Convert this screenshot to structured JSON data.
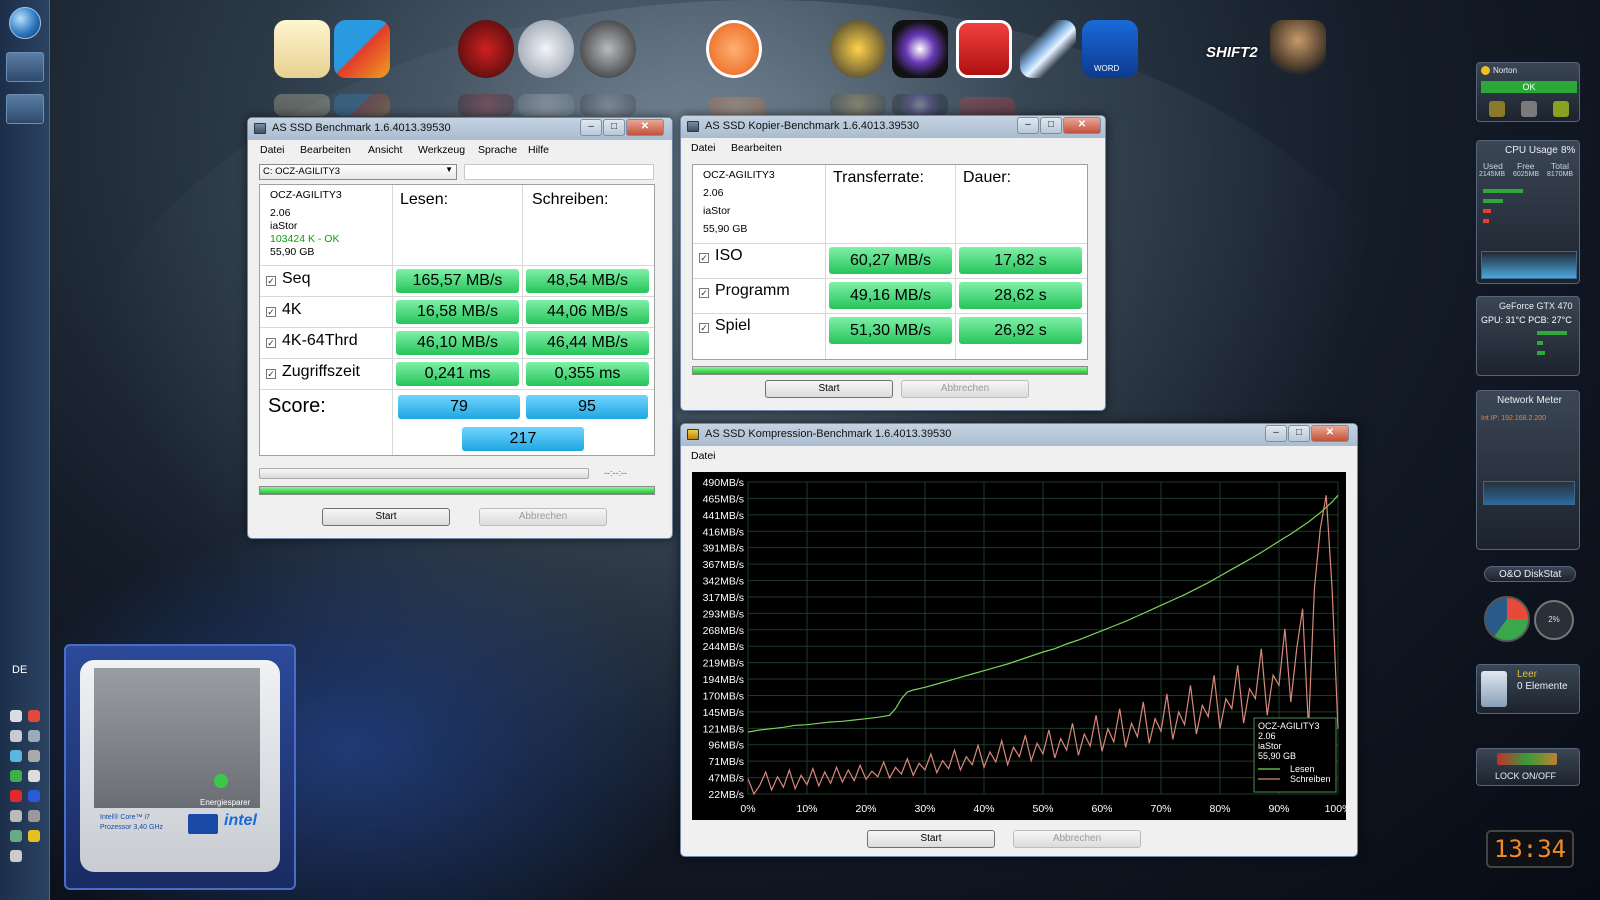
{
  "desktop": {
    "language": "DE",
    "clock": "13:34",
    "dock_icons": [
      "picasa-icon",
      "windows-live-icon",
      "guitar-hero-icon",
      "disk-icon",
      "dvd-fab-icon",
      "orange-menu-icon",
      "phoenix-icon",
      "media-player-icon",
      "r-launcher-icon",
      "feather-icon",
      "word-icon",
      "shift2-icon",
      "soldier-icon"
    ],
    "shift_label": "SHIFT2",
    "word_label": "WORD"
  },
  "gadgets": {
    "norton": {
      "title": "Norton",
      "status": "OK"
    },
    "cpu": {
      "title": "CPU Usage",
      "value": "8%",
      "cols": [
        "Used",
        "Free",
        "Total"
      ],
      "vals": [
        "2145MB",
        "6025MB",
        "8170MB"
      ]
    },
    "gpu": {
      "title": "GeForce GTX 470",
      "temp": "GPU: 31°C PCB: 27°C"
    },
    "network": {
      "title": "Network Meter",
      "ip": "Int IP: 192.168.2.200"
    },
    "diskstat": {
      "title": "O&O DiskStat",
      "value": "2%"
    },
    "recycle": {
      "title": "Leer",
      "sub": "0 Elemente"
    },
    "lock": {
      "label": "LOCK ON/OFF"
    },
    "cpu_info": {
      "line1": "Intel® Core™ i7",
      "line2": "Prozessor 3,40 GHz",
      "mode": "Energiesparer",
      "brand": "intel"
    }
  },
  "bench": {
    "title": "AS SSD Benchmark 1.6.4013.39530",
    "menu": [
      "Datei",
      "Bearbeiten",
      "Ansicht",
      "Werkzeug",
      "Sprache",
      "Hilfe"
    ],
    "drive_select": "C: OCZ-AGILITY3",
    "info": [
      "OCZ-AGILITY3",
      "2.06",
      "iaStor",
      "103424 K - OK",
      "55,90 GB"
    ],
    "col_read": "Lesen:",
    "col_write": "Schreiben:",
    "rows": [
      {
        "label": "Seq",
        "read": "165,57 MB/s",
        "write": "48,54 MB/s"
      },
      {
        "label": "4K",
        "read": "16,58 MB/s",
        "write": "44,06 MB/s"
      },
      {
        "label": "4K-64Thrd",
        "read": "46,10 MB/s",
        "write": "46,44 MB/s"
      },
      {
        "label": "Zugriffszeit",
        "read": "0,241 ms",
        "write": "0,355 ms"
      }
    ],
    "score_label": "Score:",
    "score_read": "79",
    "score_write": "95",
    "score_total": "217",
    "time_label": "--:--:--",
    "progress": 1.0,
    "start": "Start",
    "cancel": "Abbrechen"
  },
  "copy": {
    "title": "AS SSD Kopier-Benchmark 1.6.4013.39530",
    "menu": [
      "Datei",
      "Bearbeiten"
    ],
    "info": [
      "OCZ-AGILITY3",
      "2.06",
      "iaStor",
      "55,90 GB"
    ],
    "col_rate": "Transferrate:",
    "col_time": "Dauer:",
    "rows": [
      {
        "label": "ISO",
        "rate": "60,27 MB/s",
        "time": "17,82 s"
      },
      {
        "label": "Programm",
        "rate": "49,16 MB/s",
        "time": "28,62 s"
      },
      {
        "label": "Spiel",
        "rate": "51,30 MB/s",
        "time": "26,92 s"
      }
    ],
    "progress": 1.0,
    "start": "Start",
    "cancel": "Abbrechen"
  },
  "compress": {
    "title": "AS SSD Kompression-Benchmark 1.6.4013.39530",
    "menu": [
      "Datei"
    ],
    "start": "Start",
    "cancel": "Abbrechen",
    "legend_info": [
      "OCZ-AGILITY3",
      "2.06",
      "iaStor",
      "55,90 GB"
    ]
  },
  "chart_data": {
    "type": "line",
    "xlabel": "",
    "ylabel": "",
    "x_ticks": [
      "0%",
      "10%",
      "20%",
      "30%",
      "40%",
      "50%",
      "60%",
      "70%",
      "80%",
      "90%",
      "100%"
    ],
    "y_ticks": [
      "490MB/s",
      "465MB/s",
      "441MB/s",
      "416MB/s",
      "391MB/s",
      "367MB/s",
      "342MB/s",
      "317MB/s",
      "293MB/s",
      "268MB/s",
      "244MB/s",
      "219MB/s",
      "194MB/s",
      "170MB/s",
      "145MB/s",
      "121MB/s",
      "96MB/s",
      "71MB/s",
      "47MB/s",
      "22MB/s"
    ],
    "ylim": [
      22,
      490
    ],
    "xlim": [
      0,
      100
    ],
    "legend_position": "bottom-right",
    "series": [
      {
        "name": "Lesen",
        "color": "#7cd35a",
        "x": [
          0,
          2,
          4,
          6,
          8,
          10,
          12,
          14,
          16,
          18,
          20,
          22,
          24,
          25,
          26,
          27,
          28,
          30,
          32,
          34,
          36,
          38,
          40,
          42,
          44,
          46,
          48,
          50,
          52,
          54,
          56,
          58,
          60,
          62,
          64,
          66,
          68,
          70,
          72,
          74,
          76,
          78,
          80,
          82,
          84,
          86,
          88,
          90,
          92,
          94,
          95,
          96,
          97,
          98,
          99,
          100
        ],
        "y": [
          115,
          118,
          120,
          122,
          125,
          126,
          128,
          130,
          131,
          133,
          135,
          137,
          140,
          150,
          165,
          175,
          178,
          182,
          187,
          192,
          197,
          202,
          207,
          212,
          217,
          223,
          229,
          235,
          240,
          247,
          253,
          260,
          267,
          274,
          281,
          289,
          297,
          305,
          313,
          321,
          330,
          339,
          349,
          359,
          369,
          379,
          390,
          401,
          412,
          424,
          430,
          437,
          444,
          452,
          460,
          470
        ]
      },
      {
        "name": "Schreiben",
        "color": "#d98a7a",
        "x": [
          0,
          1,
          2,
          3,
          4,
          5,
          6,
          7,
          8,
          9,
          10,
          11,
          12,
          13,
          14,
          15,
          16,
          17,
          18,
          19,
          20,
          21,
          22,
          23,
          24,
          25,
          26,
          27,
          28,
          29,
          30,
          31,
          32,
          33,
          34,
          35,
          36,
          37,
          38,
          39,
          40,
          41,
          42,
          43,
          44,
          45,
          46,
          47,
          48,
          49,
          50,
          51,
          52,
          53,
          54,
          55,
          56,
          57,
          58,
          59,
          60,
          61,
          62,
          63,
          64,
          65,
          66,
          67,
          68,
          69,
          70,
          71,
          72,
          73,
          74,
          75,
          76,
          77,
          78,
          79,
          80,
          81,
          82,
          83,
          84,
          85,
          86,
          87,
          88,
          89,
          90,
          91,
          92,
          93,
          94,
          95,
          96,
          97,
          98,
          99,
          100
        ],
        "y": [
          45,
          22,
          35,
          55,
          28,
          48,
          32,
          58,
          30,
          50,
          36,
          60,
          34,
          55,
          38,
          62,
          40,
          58,
          42,
          65,
          44,
          56,
          48,
          70,
          46,
          62,
          52,
          75,
          50,
          68,
          58,
          82,
          54,
          72,
          60,
          88,
          58,
          78,
          66,
          95,
          62,
          85,
          70,
          102,
          66,
          92,
          78,
          110,
          72,
          98,
          82,
          118,
          76,
          105,
          88,
          128,
          80,
          112,
          94,
          140,
          86,
          120,
          100,
          150,
          92,
          128,
          108,
          160,
          98,
          135,
          116,
          172,
          104,
          145,
          126,
          185,
          112,
          155,
          138,
          200,
          120,
          165,
          150,
          215,
          128,
          180,
          165,
          240,
          140,
          200,
          185,
          270,
          160,
          240,
          300,
          120,
          330,
          420,
          470,
          330,
          120
        ]
      }
    ]
  }
}
